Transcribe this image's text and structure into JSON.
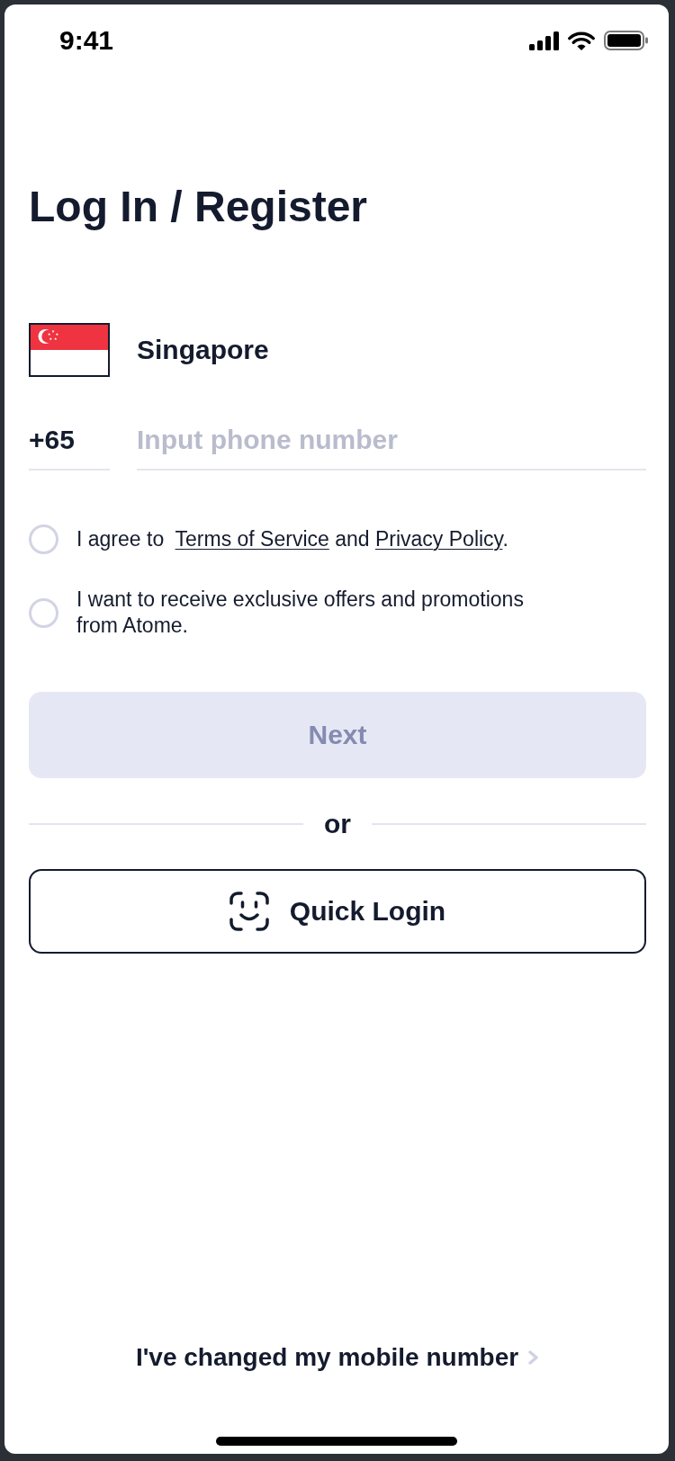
{
  "status_bar": {
    "time": "9:41"
  },
  "title": "Log In / Register",
  "country": {
    "name": "Singapore"
  },
  "phone": {
    "code": "+65",
    "placeholder": "Input phone number"
  },
  "consents": [
    {
      "checked": false,
      "parts": [
        {
          "kind": "text",
          "text": "I agree to  "
        },
        {
          "kind": "link",
          "text": "Terms of Service"
        },
        {
          "kind": "text",
          "text": " and "
        },
        {
          "kind": "link",
          "text": "Privacy Policy"
        },
        {
          "kind": "text",
          "text": "."
        }
      ]
    },
    {
      "checked": false,
      "parts": [
        {
          "kind": "text",
          "text": "I want to receive exclusive offers and promotions from Atome."
        }
      ]
    }
  ],
  "next_button": {
    "label": "Next",
    "disabled": true
  },
  "divider": {
    "label": "or"
  },
  "quick_login_button": {
    "label": "Quick Login"
  },
  "changed_number_link": {
    "label": "I've changed my mobile number"
  }
}
